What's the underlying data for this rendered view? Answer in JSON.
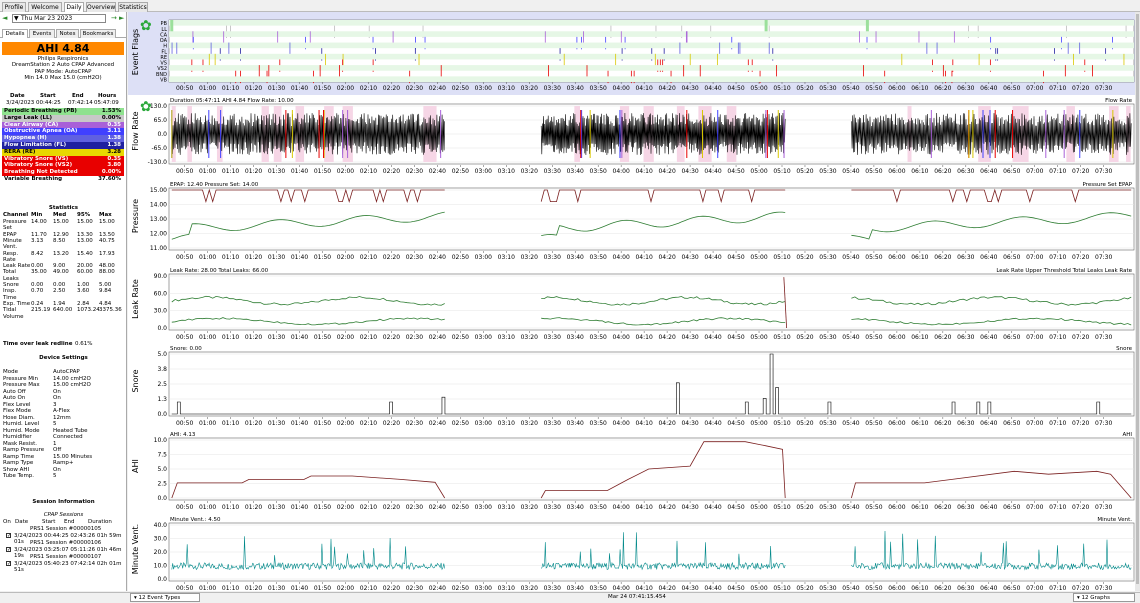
{
  "tabs": [
    "Profile",
    "Welcome",
    "Daily",
    "Overview",
    "Statistics"
  ],
  "active_tab": "Daily",
  "date": "Thu Mar 23 2023",
  "left_tabs": [
    "Details",
    "Events",
    "Notes",
    "Bookmarks"
  ],
  "ahi_label": "AHI 4.84",
  "machine": [
    "Philips Respironics",
    "DreamStation 2 Auto CPAP Advanced",
    "PAP Mode: AutoCPAP",
    "Min 14.0 Max 15.0 (cmH2O)"
  ],
  "session_header": [
    "Date",
    "Start",
    "End",
    "Hours"
  ],
  "session_row": [
    "3/24/2023",
    "00:44:25",
    "07:42:14",
    "05:47:09"
  ],
  "indices": [
    {
      "label": "Periodic Breathing (PB)",
      "value": "1.53%",
      "bg": "#8fe28f",
      "fg": "#000"
    },
    {
      "label": "Large Leak (LL)",
      "value": "0.00%",
      "bg": "#c8c8c8",
      "fg": "#000"
    },
    {
      "label": "Clear Airway (CA)",
      "value": "0.35",
      "bg": "#a860d8",
      "fg": "#fff"
    },
    {
      "label": "Obstructive Apnea (OA)",
      "value": "3.11",
      "bg": "#4040ff",
      "fg": "#fff"
    },
    {
      "label": "Hypopnea (H)",
      "value": "1.38",
      "bg": "#6060e0",
      "fg": "#fff"
    },
    {
      "label": "Flow Limitation (FL)",
      "value": "1.38",
      "bg": "#2020a0",
      "fg": "#fff"
    },
    {
      "label": "RERA (RE)",
      "value": "3.28",
      "bg": "#e8d800",
      "fg": "#000"
    },
    {
      "label": "Vibratory Snore (VS)",
      "value": "0.35",
      "bg": "#e80000",
      "fg": "#fff"
    },
    {
      "label": "Vibratory Snore (VS2)",
      "value": "3.80",
      "bg": "#e80000",
      "fg": "#fff"
    },
    {
      "label": "Breathing Not Detected",
      "value": "0.00%",
      "bg": "#e80000",
      "fg": "#fff"
    },
    {
      "label": "Variable Breathing",
      "value": "37.60%",
      "bg": "#ffffff",
      "fg": "#000"
    }
  ],
  "stats_title": "Statistics",
  "stats_header": [
    "Channel",
    "Min",
    "Med",
    "95%",
    "Max"
  ],
  "stats": [
    [
      "Pressure",
      "14.00",
      "15.00",
      "15.00",
      "15.00"
    ],
    [
      "Set",
      "",
      "",
      "",
      ""
    ],
    [
      "EPAP",
      "11.70",
      "12.90",
      "13.30",
      "13.50"
    ],
    [
      "Minute",
      "3.13",
      "8.50",
      "13.00",
      "40.75"
    ],
    [
      "Vent.",
      "",
      "",
      "",
      ""
    ],
    [
      "Resp.",
      "8.42",
      "13.20",
      "15.40",
      "17.93"
    ],
    [
      "Rate",
      "",
      "",
      "",
      ""
    ],
    [
      "Leak Rate",
      "0.00",
      "9.00",
      "20.00",
      "48.00"
    ],
    [
      "Total",
      "35.00",
      "49.00",
      "60.00",
      "88.00"
    ],
    [
      "Leaks",
      "",
      "",
      "",
      ""
    ],
    [
      "Snore",
      "0.00",
      "0.00",
      "1.00",
      "5.00"
    ],
    [
      "Insp.",
      "0.70",
      "2.50",
      "3.60",
      "9.84"
    ],
    [
      "Time",
      "",
      "",
      "",
      ""
    ],
    [
      "Exp. Time",
      "0.24",
      "1.94",
      "2.84",
      "4.84"
    ],
    [
      "Tidal",
      "215.19",
      "640.00",
      "1073.24",
      "3375.36"
    ],
    [
      "Volume",
      "",
      "",
      "",
      ""
    ]
  ],
  "redline_label": "Time over leak redline",
  "redline_value": "0.61%",
  "device_title": "Device Settings",
  "device": [
    [
      "Mode",
      "AutoCPAP"
    ],
    [
      "Pressure Min",
      "14.00 cmH2O"
    ],
    [
      "Pressure Max",
      "15.00 cmH2O"
    ],
    [
      "Auto Off",
      "On"
    ],
    [
      "Auto On",
      "On"
    ],
    [
      "Flex Level",
      "3"
    ],
    [
      "Flex Mode",
      "A-Flex"
    ],
    [
      "Hose Diam.",
      "12mm"
    ],
    [
      "Humid. Level",
      "5"
    ],
    [
      "Humid. Mode",
      "Heated Tube"
    ],
    [
      "Humidifier",
      "Connected"
    ],
    [
      "Mask Resist.",
      "1"
    ],
    [
      "Ramp Pressure",
      "Off"
    ],
    [
      "Ramp Time",
      "15.00 Minutes"
    ],
    [
      "Ramp Type",
      "Ramp+"
    ],
    [
      "Show AHI",
      "On"
    ],
    [
      "Tube Temp.",
      "5"
    ]
  ],
  "session_info_title": "Session Information",
  "cpap_sessions_label": "CPAP Sessions",
  "session_cols": [
    "On",
    "Date",
    "Start",
    "End",
    "Duration"
  ],
  "sessions": [
    {
      "name": "PRS1 Session #00000105",
      "row": "3/24/2023 00:44:25 02:43:26 01h 59m 01s"
    },
    {
      "name": "PRS1 Session #00000106",
      "row": "3/24/2023 03:25:07 05:11:26 01h 46m 19s"
    },
    {
      "name": "PRS1 Session #00000107",
      "row": "3/24/2023 05:40:23 07:42:14 02h 01m 51s"
    }
  ],
  "duration_buttons": [
    "1h 59m",
    "1h 46m",
    "2h 1m"
  ],
  "event_flag_labels": [
    "PB",
    "LL",
    "CA",
    "OA",
    "H",
    "FL",
    "RE",
    "VS",
    "VS2",
    "BND",
    "VB"
  ],
  "graphs": [
    {
      "title": "Event Flags",
      "header": "",
      "legend": ""
    },
    {
      "title": "Flow Rate",
      "header": "Duration 05:47:11 AHI 4.84 Flow Rate: 10.00",
      "legend": "Flow Rate",
      "ticks": [
        "130.0",
        "65.0",
        "0.0",
        "-65.0",
        "-130.0"
      ]
    },
    {
      "title": "Pressure",
      "header": "EPAP: 12.40 Pressure Set: 14.00",
      "legend": "Pressure Set EPAP",
      "ticks": [
        "15.00",
        "14.00",
        "13.00",
        "12.00",
        "11.00"
      ]
    },
    {
      "title": "Leak Rate",
      "header": "Leak Rate: 28.00 Total Leaks: 66.00",
      "legend": "Leak Rate Upper Threshold Total Leaks Leak Rate",
      "ticks": [
        "90.0",
        "60.0",
        "30.0",
        "0.0"
      ]
    },
    {
      "title": "Snore",
      "header": "Snore: 0.00",
      "legend": "Snore",
      "ticks": [
        "5.0",
        "3.8",
        "2.5",
        "1.3",
        "0.0"
      ]
    },
    {
      "title": "AHI",
      "header": "AHI: 4.13",
      "legend": "AHI",
      "ticks": [
        "10.0",
        "7.5",
        "5.0",
        "2.5",
        "0.0"
      ]
    },
    {
      "title": "Minute Vent.",
      "header": "Minute Vent.: 4.50",
      "legend": "Minute Vent.",
      "ticks": [
        "40.0",
        "30.0",
        "20.0",
        "10.0",
        "0.0"
      ]
    }
  ],
  "time_labels": [
    "00:50",
    "01:00",
    "01:10",
    "01:20",
    "01:30",
    "01:40",
    "01:50",
    "02:00",
    "02:10",
    "02:20",
    "02:30",
    "02:40",
    "02:50",
    "03:00",
    "03:10",
    "03:20",
    "03:30",
    "03:40",
    "03:50",
    "04:00",
    "04:10",
    "04:20",
    "04:30",
    "04:40",
    "04:50",
    "05:00",
    "05:10",
    "05:20",
    "05:30",
    "05:40",
    "05:50",
    "06:00",
    "06:10",
    "06:20",
    "06:30",
    "06:40",
    "06:50",
    "07:00",
    "07:10",
    "07:20",
    "07:30"
  ],
  "status": {
    "event_types": "12 Event Types",
    "timestamp": "Mar 24 07:41:15.454",
    "graphs": "12 Graphs"
  },
  "colors": {
    "accent": "#ff8800",
    "flow": "#000000",
    "pressure_set": "#7a1f1f",
    "epap": "#2e7d32",
    "leak": "#2e7d32",
    "ahi": "#7a1f1f",
    "minvent": "#00898a"
  }
}
